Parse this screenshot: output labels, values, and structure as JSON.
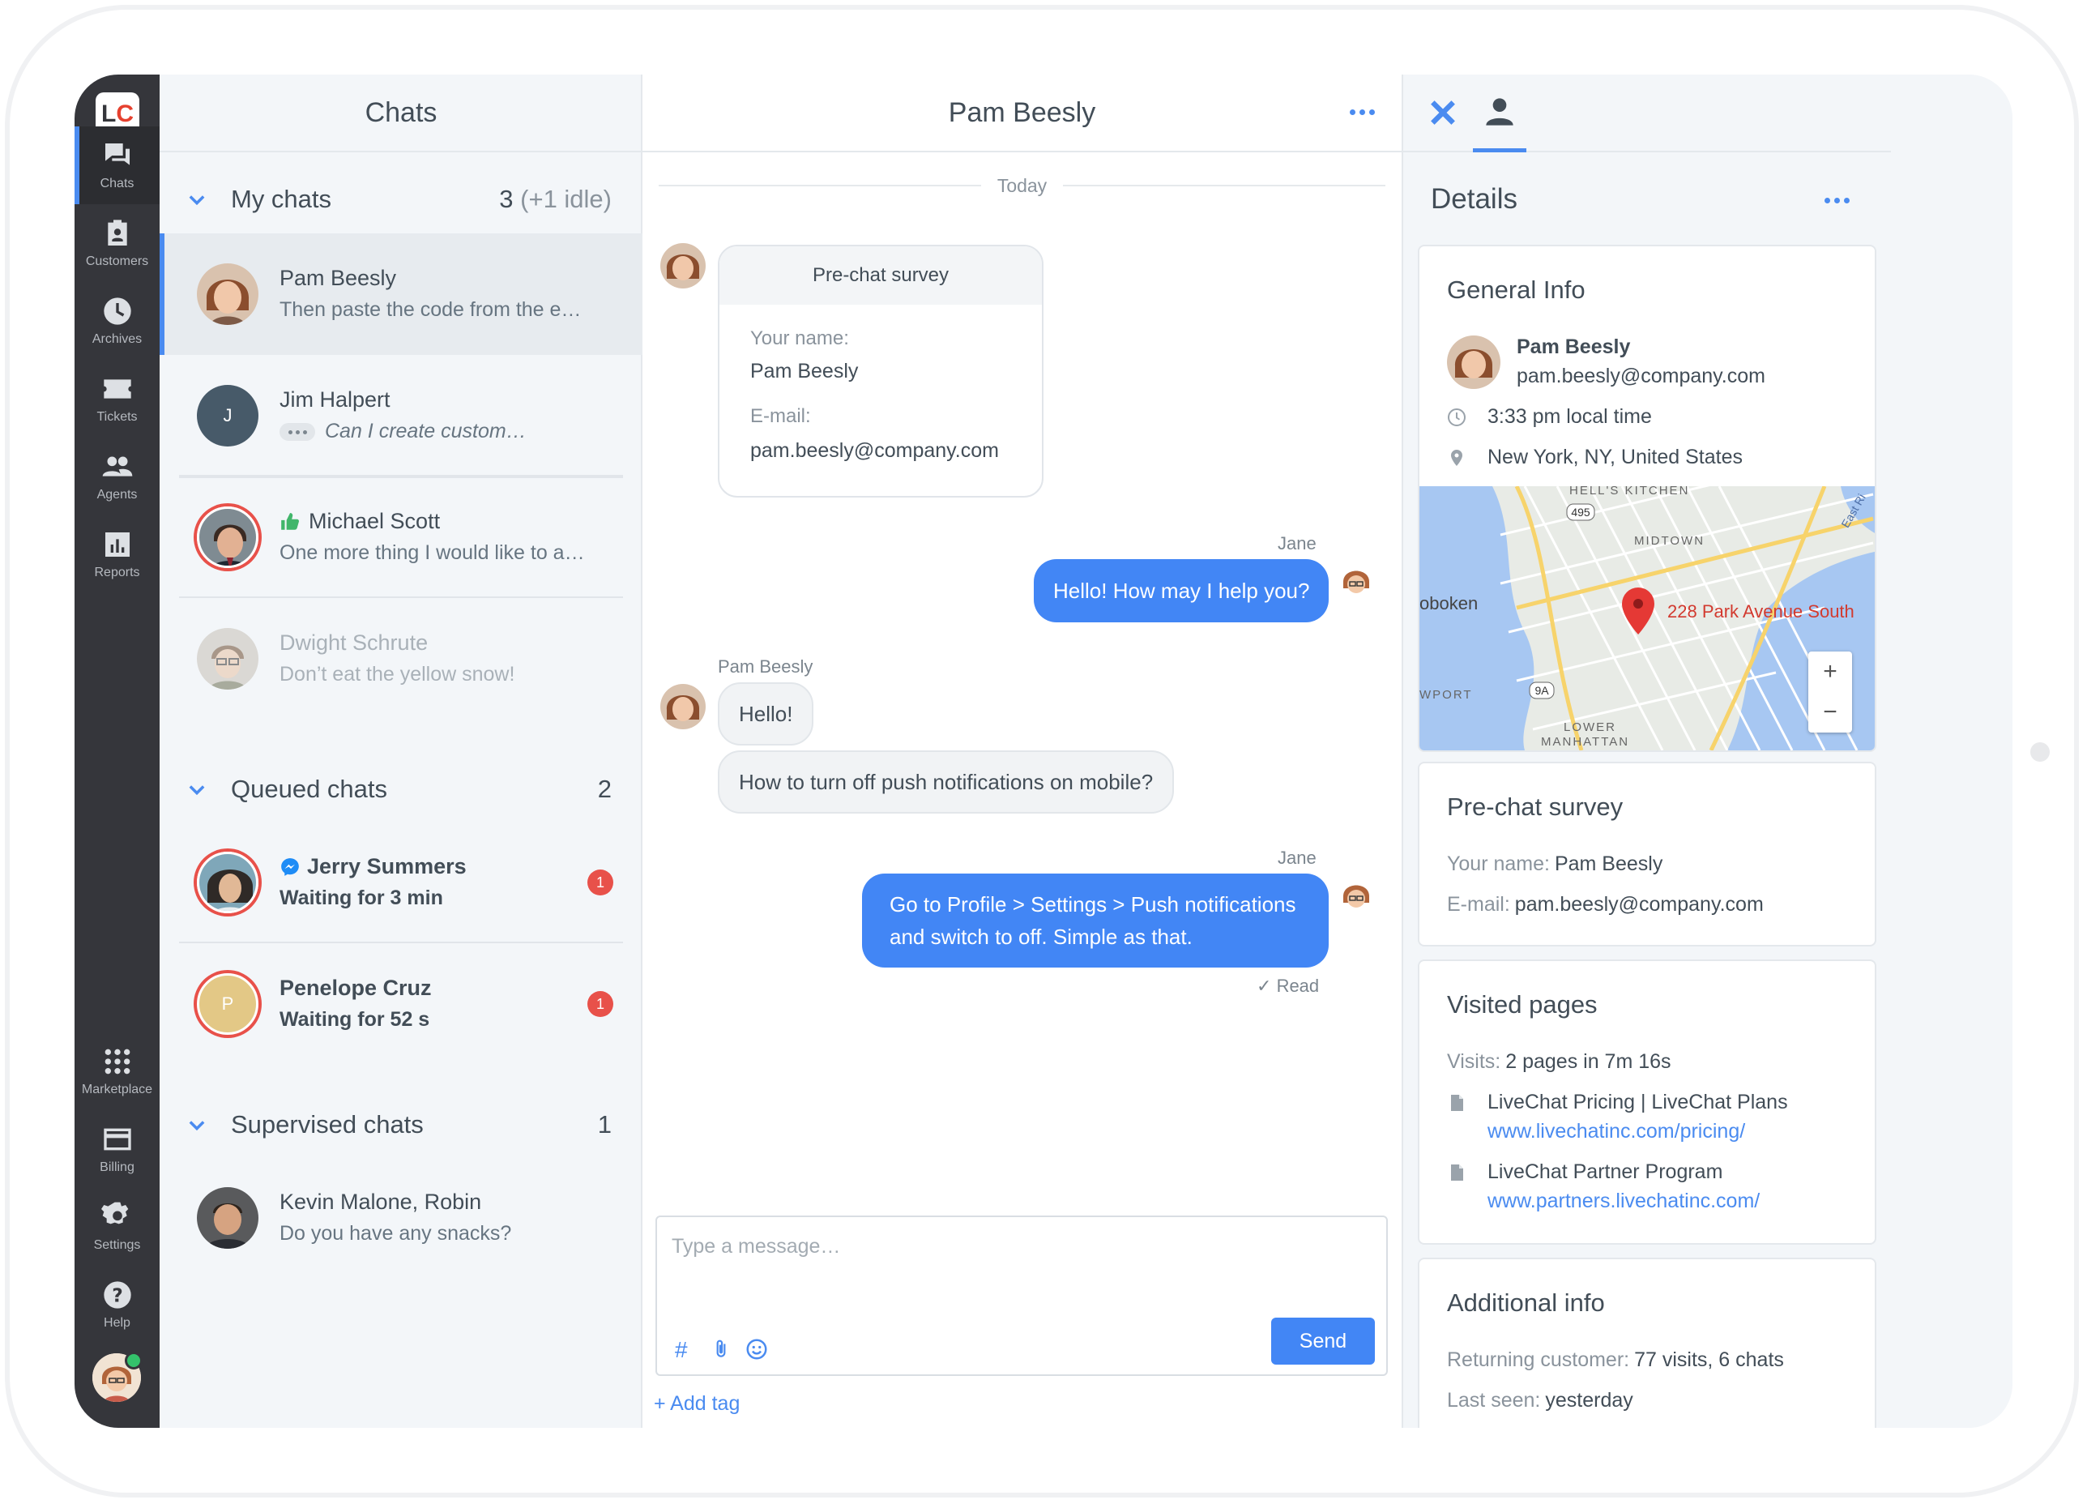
{
  "nav": {
    "logo_l": "L",
    "logo_c": "C",
    "items": [
      {
        "label": "Chats",
        "icon": "chats-icon"
      },
      {
        "label": "Customers",
        "icon": "customers-icon"
      },
      {
        "label": "Archives",
        "icon": "archives-icon"
      },
      {
        "label": "Tickets",
        "icon": "tickets-icon"
      },
      {
        "label": "Agents",
        "icon": "agents-icon"
      },
      {
        "label": "Reports",
        "icon": "reports-icon"
      },
      {
        "label": "Marketplace",
        "icon": "marketplace-icon"
      },
      {
        "label": "Billing",
        "icon": "billing-icon"
      },
      {
        "label": "Settings",
        "icon": "settings-icon"
      },
      {
        "label": "Help",
        "icon": "help-icon"
      }
    ]
  },
  "chats": {
    "title": "Chats",
    "my": {
      "title": "My chats",
      "count": "3",
      "idle": "(+1 idle)"
    },
    "queued": {
      "title": "Queued chats",
      "count": "2"
    },
    "supervised": {
      "title": "Supervised chats",
      "count": "1"
    },
    "items": [
      {
        "name": "Pam Beesly",
        "msg": "Then paste the code from the e…"
      },
      {
        "name": "Jim Halpert",
        "initial": "J",
        "msg": "Can I create custom…"
      },
      {
        "name": "Michael Scott",
        "msg": "One more thing I would like to a…"
      },
      {
        "name": "Dwight Schrute",
        "msg": "Don’t eat the yellow snow!"
      },
      {
        "name": "Jerry Summers",
        "msg": "Waiting for 3 min",
        "badge": "1"
      },
      {
        "name": "Penelope Cruz",
        "initial": "P",
        "msg": "Waiting for 52 s",
        "badge": "1"
      },
      {
        "name": "Kevin Malone, Robin",
        "msg": "Do you have any snacks?"
      }
    ]
  },
  "conversation": {
    "title": "Pam Beesly",
    "day": "Today",
    "survey": {
      "title": "Pre-chat survey",
      "name_label": "Your name:",
      "name": "Pam Beesly",
      "email_label": "E-mail:",
      "email": "pam.beesly@company.com"
    },
    "messages": [
      {
        "sender": "Jane",
        "text": "Hello! How may I help you?"
      },
      {
        "sender": "Pam Beesly",
        "text": "Hello!"
      },
      {
        "text": "How to turn off push notifications on mobile?"
      },
      {
        "sender": "Jane",
        "text": "Go to Profile > Settings > Push notifications and switch to off. Simple as that."
      }
    ],
    "read": "Read",
    "placeholder": "Type a message…",
    "send": "Send",
    "add_tag": "+ Add tag"
  },
  "details": {
    "title": "Details",
    "general": {
      "title": "General Info",
      "name": "Pam Beesly",
      "email": "pam.beesly@company.com",
      "time": "3:33 pm local time",
      "location": "New York, NY, United States",
      "map_pin": "228 Park Avenue South",
      "map_labels": [
        "HELL'S KITCHEN",
        "MIDTOWN",
        "oboken",
        "WPORT",
        "LOWER",
        "MANHATTAN",
        "495",
        "9A",
        "East Ri"
      ],
      "zoom_in": "+",
      "zoom_out": "−"
    },
    "survey": {
      "title": "Pre-chat survey",
      "name_label": "Your name:",
      "name": "Pam Beesly",
      "email_label": "E-mail:",
      "email": "pam.beesly@company.com"
    },
    "visited": {
      "title": "Visited pages",
      "visits_label": "Visits:",
      "visits": "2 pages in 7m 16s",
      "pages": [
        {
          "title": "LiveChat Pricing | LiveChat Plans",
          "url": "www.livechatinc.com/pricing/"
        },
        {
          "title": "LiveChat Partner Program",
          "url": "www.partners.livechatinc.com/"
        }
      ]
    },
    "additional": {
      "title": "Additional info",
      "returning_label": "Returning customer:",
      "returning": "77 visits, 6 chats",
      "seen_label": "Last seen:",
      "seen": "yesterday"
    }
  },
  "colors": {
    "accent": "#4286f5",
    "nav": "#35363b",
    "alert": "#e8514a",
    "online": "#34c26b"
  }
}
